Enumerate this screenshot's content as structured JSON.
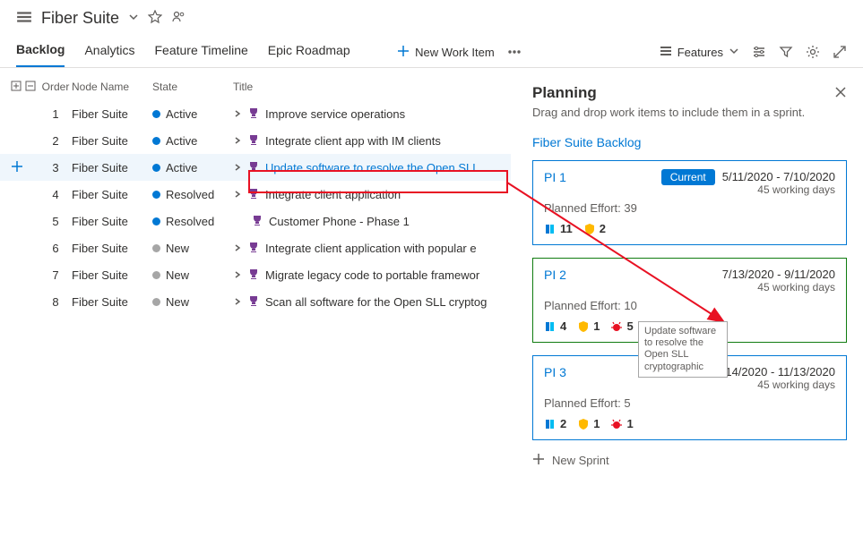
{
  "header": {
    "project": "Fiber Suite"
  },
  "tabs": [
    "Backlog",
    "Analytics",
    "Feature Timeline",
    "Epic Roadmap"
  ],
  "toolbar": {
    "new_item": "New Work Item",
    "features": "Features"
  },
  "grid": {
    "columns": {
      "order": "Order",
      "node": "Node Name",
      "state": "State",
      "title": "Title"
    },
    "rows": [
      {
        "order": "1",
        "node": "Fiber Suite",
        "state": "Active",
        "state_cls": "active",
        "title": "Improve service operations",
        "chev": true
      },
      {
        "order": "2",
        "node": "Fiber Suite",
        "state": "Active",
        "state_cls": "active",
        "title": "Integrate client app with IM clients",
        "chev": true
      },
      {
        "order": "3",
        "node": "Fiber Suite",
        "state": "Active",
        "state_cls": "active",
        "title": "Update software to resolve the Open SLL",
        "chev": true,
        "selected": true
      },
      {
        "order": "4",
        "node": "Fiber Suite",
        "state": "Resolved",
        "state_cls": "resolved",
        "title": "Integrate client application",
        "chev": true
      },
      {
        "order": "5",
        "node": "Fiber Suite",
        "state": "Resolved",
        "state_cls": "resolved",
        "title": "Customer Phone - Phase 1",
        "chev": false
      },
      {
        "order": "6",
        "node": "Fiber Suite",
        "state": "New",
        "state_cls": "new",
        "title": "Integrate client application with popular e",
        "chev": true
      },
      {
        "order": "7",
        "node": "Fiber Suite",
        "state": "New",
        "state_cls": "new",
        "title": "Migrate legacy code to portable framewor",
        "chev": true
      },
      {
        "order": "8",
        "node": "Fiber Suite",
        "state": "New",
        "state_cls": "new",
        "title": "Scan all software for the Open SLL cryptog",
        "chev": true
      }
    ]
  },
  "panel": {
    "title": "Planning",
    "sub": "Drag and drop work items to include them in a sprint.",
    "backlog_link": "Fiber Suite Backlog",
    "sprints": [
      {
        "name": "PI 1",
        "effort": "Planned Effort: 39",
        "dates": "5/11/2020 - 7/10/2020",
        "days": "45 working days",
        "current": true,
        "badges": [
          {
            "t": "book",
            "n": "11"
          },
          {
            "t": "shield",
            "n": "2"
          }
        ]
      },
      {
        "name": "PI 2",
        "effort": "Planned Effort: 10",
        "dates": "7/13/2020 - 9/11/2020",
        "days": "45 working days",
        "green": true,
        "badges": [
          {
            "t": "book",
            "n": "4"
          },
          {
            "t": "shield",
            "n": "1"
          },
          {
            "t": "bug",
            "n": "5"
          }
        ]
      },
      {
        "name": "PI 3",
        "effort": "Planned Effort: 5",
        "dates": "9/14/2020 - 11/13/2020",
        "days": "45 working days",
        "badges": [
          {
            "t": "book",
            "n": "2"
          },
          {
            "t": "shield",
            "n": "1"
          },
          {
            "t": "bug",
            "n": "1"
          }
        ]
      }
    ],
    "new_sprint": "New Sprint",
    "current_label": "Current"
  },
  "ghost": "Update software to resolve the Open SLL cryptographic"
}
